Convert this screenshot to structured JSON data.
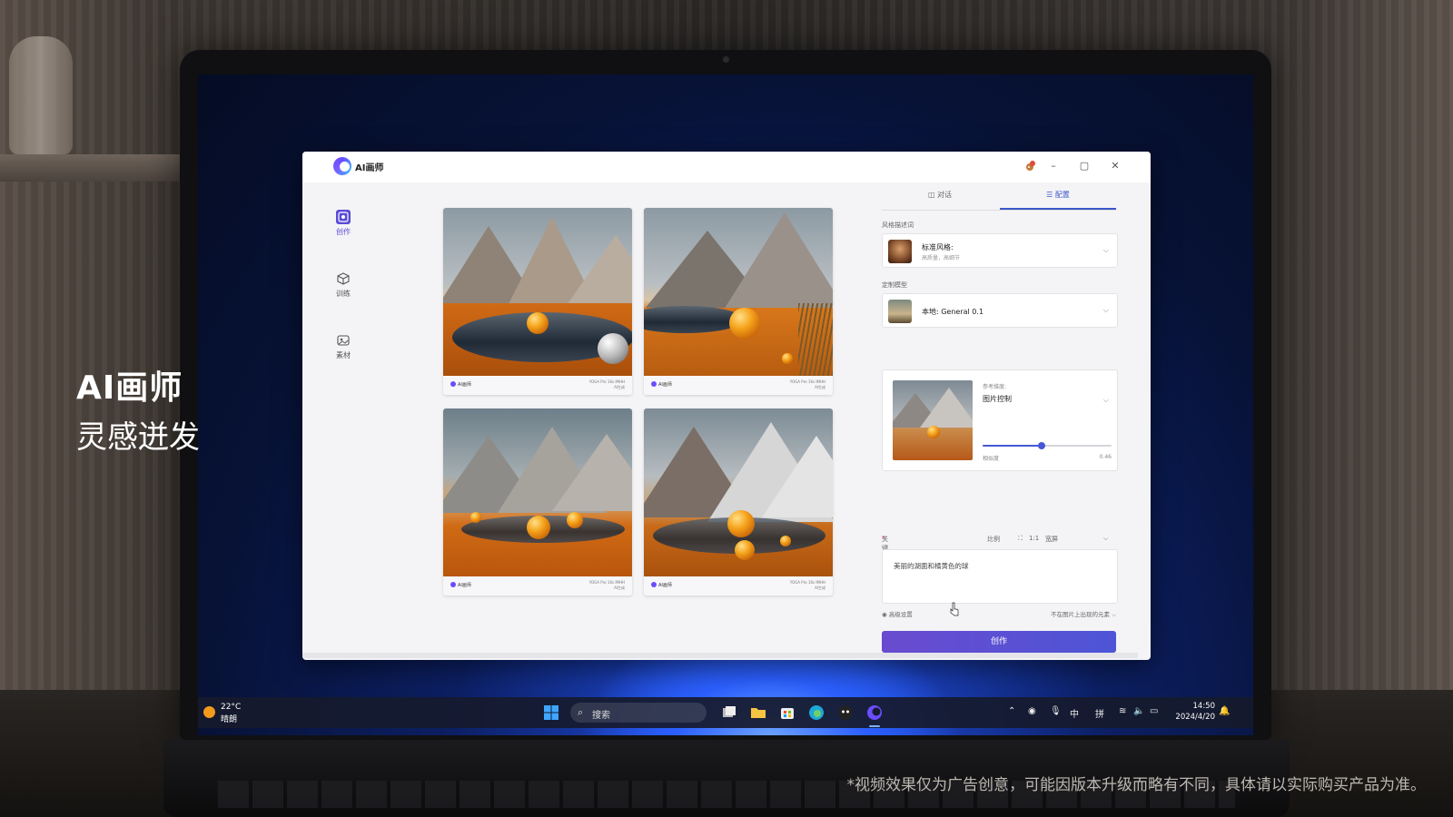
{
  "overlay": {
    "headline": "AI画师",
    "tagline": "灵感迸发",
    "disclaimer": "*视频效果仅为广告创意，可能因版本升级而略有不同，具体请以实际购买产品为准。"
  },
  "app": {
    "title": "AI画师",
    "window_controls": [
      "minimize",
      "maximize",
      "close"
    ]
  },
  "sidebar": {
    "items": [
      {
        "label": "创作",
        "icon": "palette-icon",
        "active": true
      },
      {
        "label": "训练",
        "icon": "cube-icon",
        "active": false
      },
      {
        "label": "素材",
        "icon": "image-icon",
        "active": false
      }
    ]
  },
  "gallery": {
    "cards": [
      {
        "brand": "AI画师",
        "model_line1": "YOGA Pro 16s IMHH",
        "model_line2": "AI生成"
      },
      {
        "brand": "AI画师",
        "model_line1": "YOGA Pro 16s IMHH",
        "model_line2": "AI生成"
      },
      {
        "brand": "AI画师",
        "model_line1": "YOGA Pro 16s IMHH",
        "model_line2": "AI生成"
      },
      {
        "brand": "AI画师",
        "model_line1": "YOGA Pro 16s IMHH",
        "model_line2": "AI生成"
      }
    ]
  },
  "panel": {
    "tabs": [
      {
        "label": "对话",
        "active": false
      },
      {
        "label": "配置",
        "active": true
      }
    ],
    "style": {
      "label": "风格描述词",
      "title": "标准风格:",
      "sub": "高质量，高细节"
    },
    "model": {
      "label": "定制模型",
      "title": "本地: General 0.1"
    },
    "reference": {
      "label": "参考维度:",
      "value": "图片控制",
      "slider_name": "相似度",
      "slider_value": "0.46",
      "slider_fraction": 0.46
    },
    "keywords": {
      "label": "关键词",
      "required_mark": "*",
      "ratio_label": "比例",
      "ratio_value": "1:1",
      "ratio_name": "宽屏",
      "prompt": "美丽的湖面和橘黄色的球"
    },
    "advanced": {
      "label": "高级设置",
      "negative_label": "不在图片上出现的元素"
    },
    "create_label": "创作"
  },
  "taskbar": {
    "temperature": "22°C",
    "condition": "晴朗",
    "search_placeholder": "搜索",
    "ime_mode": "中",
    "ime_input": "拼",
    "time": "14:50",
    "date": "2024/4/20"
  },
  "colors": {
    "accent": "#4658d6",
    "button_gradient_start": "#6a4bd0",
    "taskbar": "#161a2c"
  }
}
